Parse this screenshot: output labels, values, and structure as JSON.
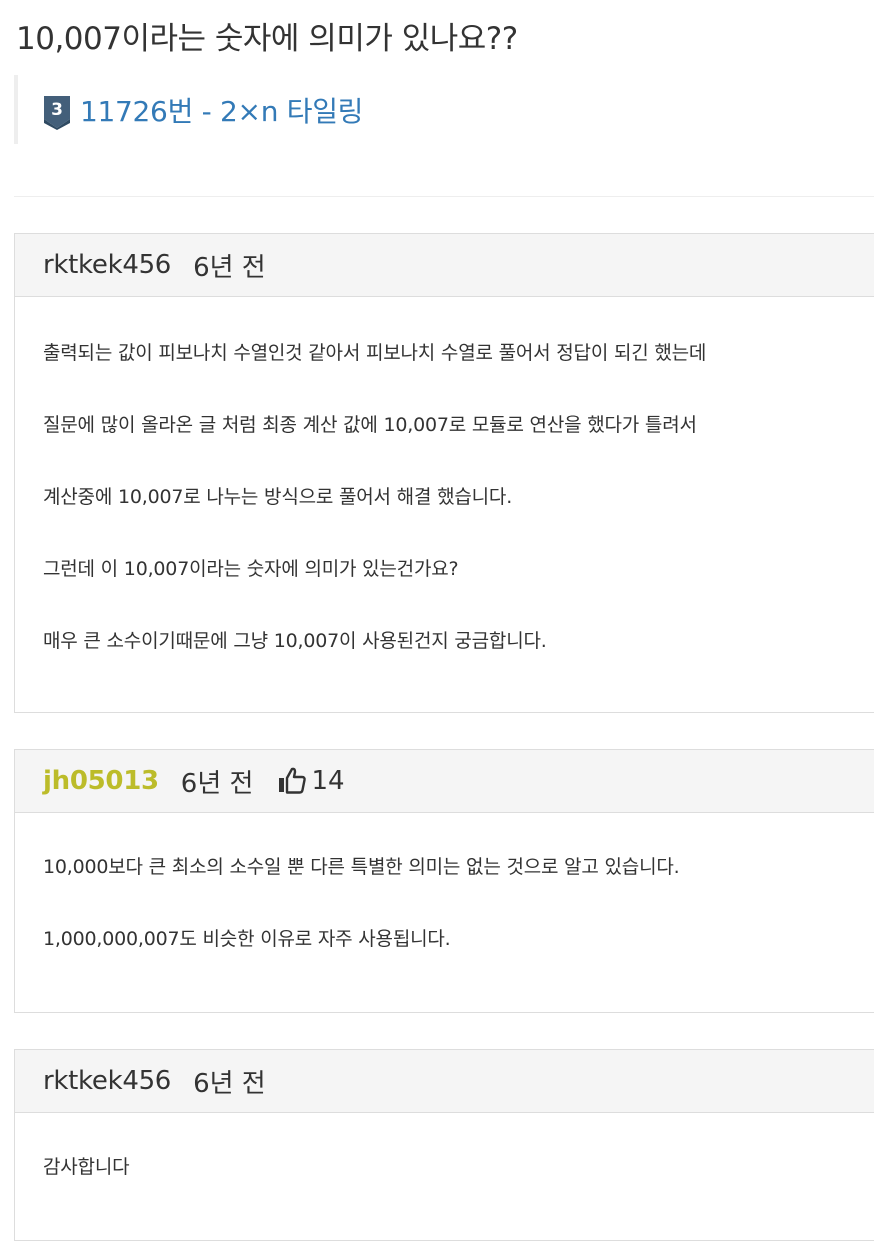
{
  "question": {
    "title": "10,007이라는 숫자에 의미가 있나요??"
  },
  "problem": {
    "tier_number": "3",
    "tier_color": "#435f7a",
    "link_text": "11726번 - 2×n 타일링",
    "link_color": "#337ab7"
  },
  "posts": [
    {
      "author": "rktkek456",
      "time": "6년 전",
      "paragraphs": [
        "출력되는 값이 피보나치 수열인것 같아서 피보나치 수열로 풀어서 정답이 되긴 했는데",
        "질문에 많이 올라온 글 처럼 최종 계산 값에 10,007로 모듈로 연산을 했다가 틀려서",
        "계산중에 10,007로 나누는 방식으로 풀어서 해결 했습니다.",
        "그런데 이 10,007이라는 숫자에 의미가 있는건가요?",
        "매우 큰 소수이기때문에 그냥 10,007이 사용된건지 궁금합니다."
      ]
    },
    {
      "author": "jh05013",
      "author_color": "#bcbc2a",
      "time": "6년 전",
      "like_icon": "thumbs-up-icon",
      "likes": "14",
      "paragraphs": [
        "10,000보다 큰 최소의 소수일 뿐 다른 특별한 의미는 없는 것으로 알고 있습니다.",
        "1,000,000,007도 비슷한 이유로 자주 사용됩니다."
      ]
    },
    {
      "author": "rktkek456",
      "time": "6년 전",
      "paragraphs": [
        "감사합니다"
      ]
    }
  ]
}
